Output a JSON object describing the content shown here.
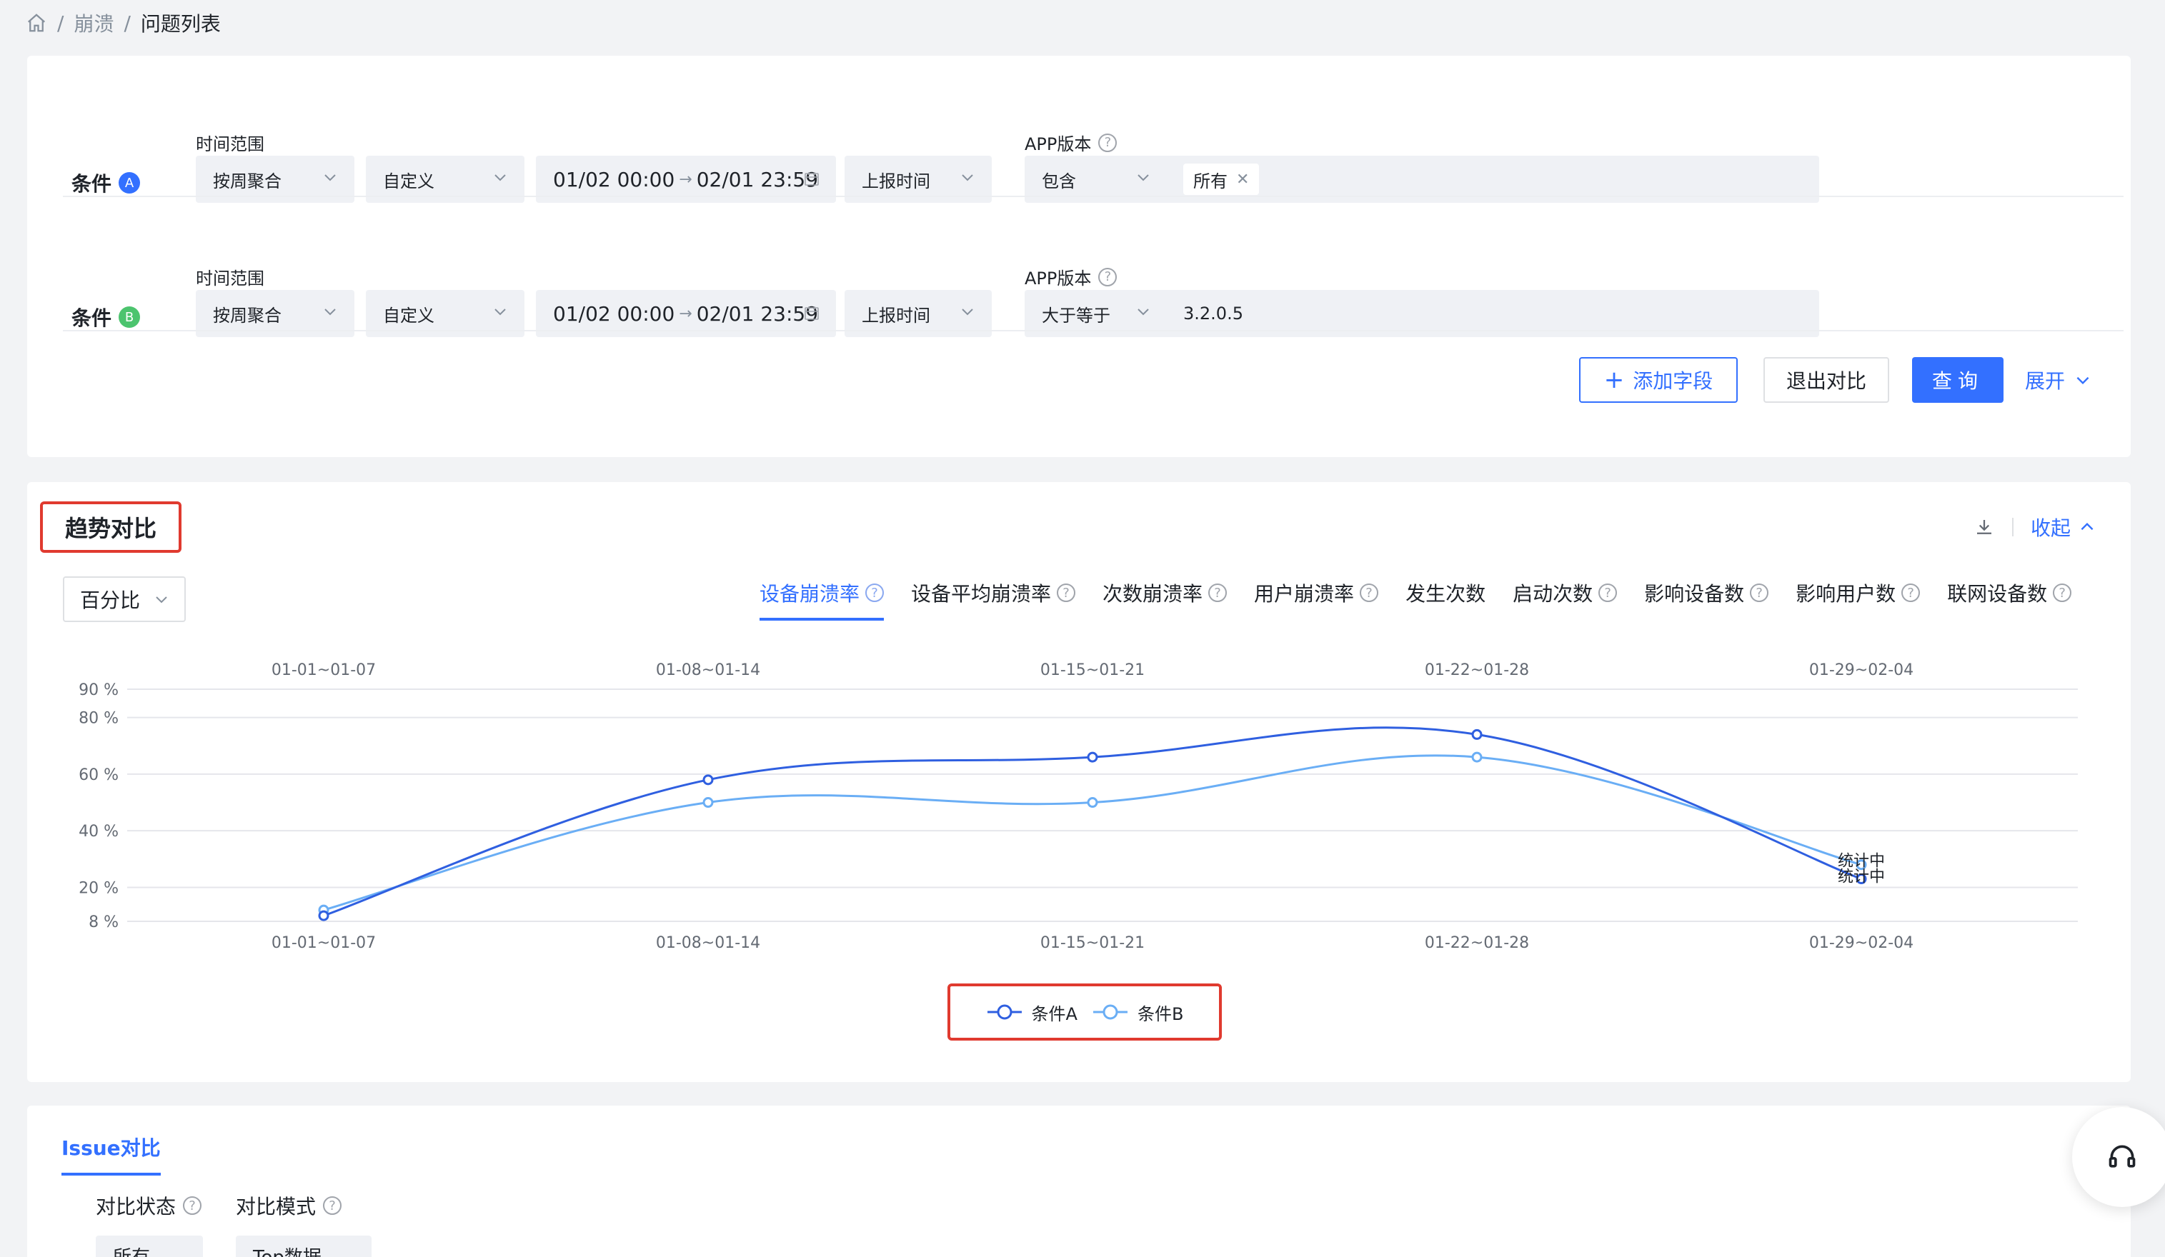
{
  "breadcrumb": {
    "items": [
      "崩溃",
      "问题列表"
    ]
  },
  "conditions": {
    "a": {
      "label": "条件",
      "badge": "A",
      "time_range_title": "时间范围",
      "aggregate": "按周聚合",
      "mode": "自定义",
      "date_start": "01/02 00:00",
      "date_end": "02/01 23:59",
      "time_type": "上报时间",
      "app_version_title": "APP版本",
      "version_op": "包含",
      "version_value": "所有"
    },
    "b": {
      "label": "条件",
      "badge": "B",
      "time_range_title": "时间范围",
      "aggregate": "按周聚合",
      "mode": "自定义",
      "date_start": "01/02 00:00",
      "date_end": "02/01 23:59",
      "time_type": "上报时间",
      "app_version_title": "APP版本",
      "version_op": "大于等于",
      "version_value": "3.2.0.5"
    }
  },
  "actions": {
    "add_field": "添加字段",
    "exit_compare": "退出对比",
    "query": "查询",
    "expand": "展开"
  },
  "trend": {
    "title": "趋势对比",
    "collapse": "收起",
    "unit_select": "百分比",
    "tabs": [
      "设备崩溃率",
      "设备平均崩溃率",
      "次数崩溃率",
      "用户崩溃率",
      "发生次数",
      "启动次数",
      "影响设备数",
      "影响用户数",
      "联网设备数"
    ],
    "tab_help": [
      true,
      true,
      true,
      true,
      false,
      true,
      true,
      true,
      true
    ],
    "active_tab": 0,
    "pending_label": "统计中"
  },
  "chart_data": {
    "type": "line",
    "categories": [
      "01-01~01-07",
      "01-08~01-14",
      "01-15~01-21",
      "01-22~01-28",
      "01-29~02-04"
    ],
    "series": [
      {
        "name": "条件A",
        "values": [
          10,
          58,
          66,
          74,
          23
        ],
        "color": "#2f5fe0"
      },
      {
        "name": "条件B",
        "values": [
          12,
          50,
          50,
          66,
          28
        ],
        "color": "#6aaef5"
      }
    ],
    "yticks": [
      8,
      20,
      40,
      60,
      80,
      90
    ],
    "ytick_labels": [
      "8 %",
      "20 %",
      "40 %",
      "60 %",
      "80 %",
      "90 %"
    ],
    "ylim": [
      8,
      90
    ],
    "grid": true,
    "legend": "bottom-center"
  },
  "issue": {
    "tab": "Issue对比",
    "status_label": "对比状态",
    "mode_label": "对比模式",
    "status_value": "所有",
    "mode_value": "Top数据"
  }
}
